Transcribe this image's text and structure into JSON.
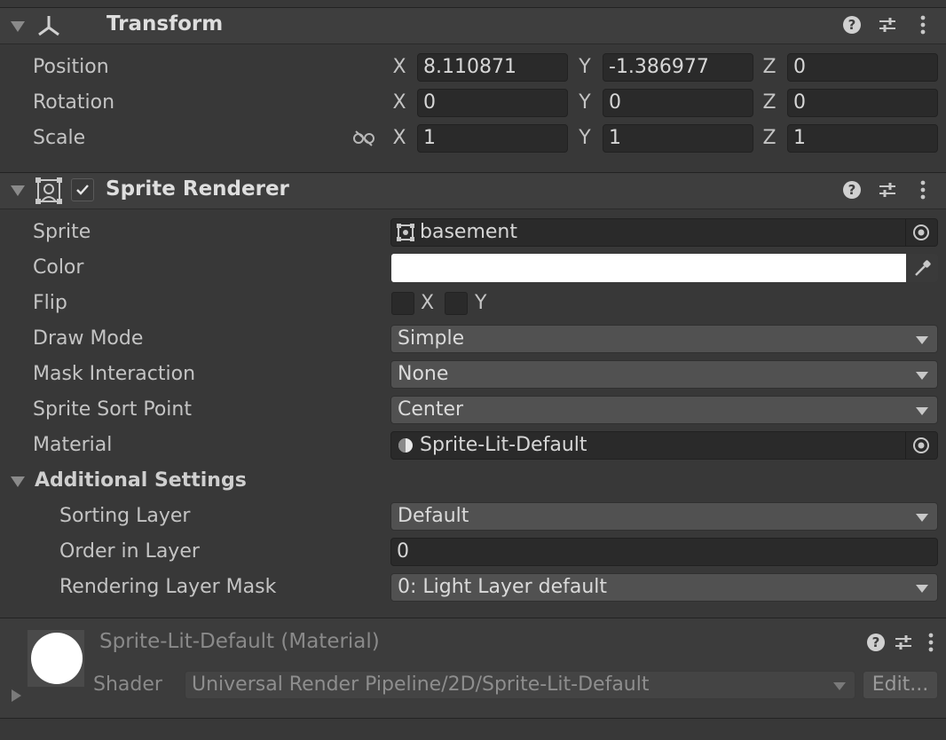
{
  "transform": {
    "title": "Transform",
    "rows": [
      {
        "label": "Position",
        "x": "8.110871",
        "y": "-1.386977",
        "z": "0"
      },
      {
        "label": "Rotation",
        "x": "0",
        "y": "0",
        "z": "0"
      },
      {
        "label": "Scale",
        "x": "1",
        "y": "1",
        "z": "1"
      }
    ],
    "axes": {
      "x": "X",
      "y": "Y",
      "z": "Z"
    }
  },
  "sprite_renderer": {
    "title": "Sprite Renderer",
    "enabled": true,
    "sprite_label": "Sprite",
    "sprite_value": "basement",
    "color_label": "Color",
    "color_value": "#ffffff",
    "flip_label": "Flip",
    "flip_x": "X",
    "flip_y": "Y",
    "draw_mode_label": "Draw Mode",
    "draw_mode_value": "Simple",
    "mask_label": "Mask Interaction",
    "mask_value": "None",
    "sort_point_label": "Sprite Sort Point",
    "sort_point_value": "Center",
    "material_label": "Material",
    "material_value": "Sprite-Lit-Default",
    "additional_label": "Additional Settings",
    "sorting_layer_label": "Sorting Layer",
    "sorting_layer_value": "Default",
    "order_label": "Order in Layer",
    "order_value": "0",
    "rlm_label": "Rendering Layer Mask",
    "rlm_value": "0: Light Layer default"
  },
  "material": {
    "title": "Sprite-Lit-Default (Material)",
    "shader_label": "Shader",
    "shader_value": "Universal Render Pipeline/2D/Sprite-Lit-Default",
    "edit_label": "Edit..."
  }
}
